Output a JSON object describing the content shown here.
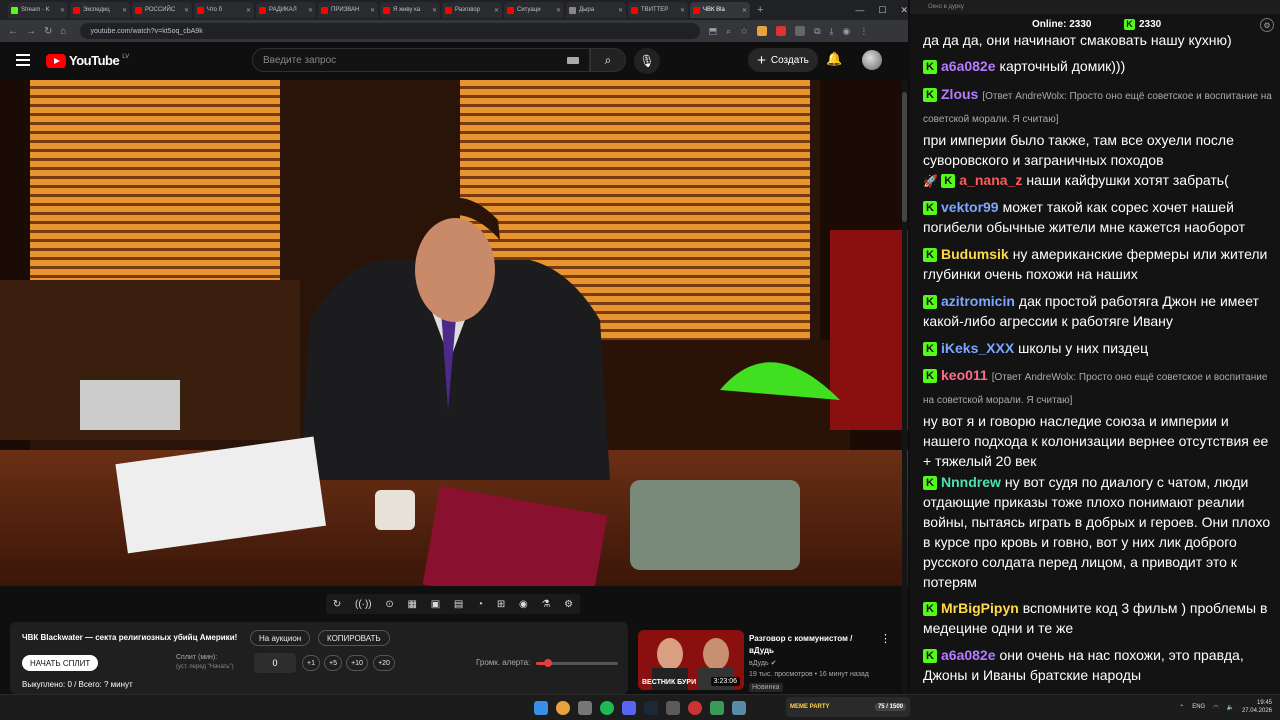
{
  "browser": {
    "tabs": [
      {
        "title": "Stream - K",
        "color": "#53fc18"
      },
      {
        "title": "Экспедиц",
        "color": "#ff0000"
      },
      {
        "title": "РОССИЙС",
        "color": "#ff0000"
      },
      {
        "title": "Что б",
        "color": "#ff0000"
      },
      {
        "title": "РАДИКАЛ",
        "color": "#ff0000"
      },
      {
        "title": "ПРИЗВАН",
        "color": "#ff0000"
      },
      {
        "title": "Я живу ка",
        "color": "#ff0000"
      },
      {
        "title": "Разговор",
        "color": "#ff0000"
      },
      {
        "title": "Ситуаци",
        "color": "#ff0000"
      },
      {
        "title": "Дыра",
        "color": "#888888"
      },
      {
        "title": "ТВИТТЕР",
        "color": "#ff0000"
      },
      {
        "title": "ЧВК Bla",
        "color": "#ff0000",
        "active": true
      }
    ],
    "url": "youtube.com/watch?v=kt5oq_cbA9k"
  },
  "youtube": {
    "logo_text": "YouTube",
    "region": "LV",
    "search_placeholder": "Введите запрос",
    "create_label": "Создать"
  },
  "player_controls": [
    "↻",
    "((·))",
    "⊙",
    "▦",
    "▣",
    "▤",
    "◔",
    "⊞",
    "◉",
    "⚗",
    "⚙"
  ],
  "auction": {
    "title": "ЧВК Blackwater — секта религиозных убийц Америки!",
    "btn_auction": "На аукцион",
    "btn_copy": "КОПИРОВАТЬ",
    "btn_start": "НАЧАТЬ СПЛИТ",
    "split_label": "Сплит (мин):",
    "split_sub": "(уст. перед \"Начать\")",
    "split_value": "0",
    "increments": [
      "+1",
      "+5",
      "+10",
      "+20"
    ],
    "volume_label": "Громк. алерта:",
    "volume_level": 0.15,
    "sold_text": "Выкуплено: 0 / Всего: ? минут"
  },
  "recommendation": {
    "title": "Разговор с коммунистом / вДудь",
    "channel": "вДудь",
    "meta": "19 тыс. просмотров • 16 минут назад",
    "badge_new": "Новинка",
    "duration": "3:23:06",
    "thumb_text": "ВЕСТНИК БУРИ"
  },
  "chat": {
    "window_title": "Окно в дурку",
    "online_label": "Online:",
    "online_count": "2330",
    "viewers_count": "2330",
    "messages": [
      {
        "user": "",
        "text": "да да да, они начинают смаковать нашу кухню)",
        "color": "#ffffff",
        "reply": ""
      },
      {
        "user": "a6a082e",
        "text": "карточный домик)))",
        "color": "#b57bff",
        "reply": ""
      },
      {
        "user": "Zlous",
        "text": "при империи было также, там все охуели после суворовского и заграничных походов",
        "color": "#b57bff",
        "reply": "[Ответ AndreWolx: Просто оно ещё советское и воспитание на советской морали. Я считаю]"
      },
      {
        "user": "a_nana_z",
        "text": "наши кайфушки хотят забрать(",
        "color": "#ff5a5a",
        "reply": ""
      },
      {
        "user": "vektor99",
        "text": "может такой как сорес хочет нашей погибели обычные жители мне кажется наоборот",
        "color": "#7aa7ff",
        "reply": ""
      },
      {
        "user": "Budumsik",
        "text": "ну американские фермеры или жители глубинки очень похожи на наших",
        "color": "#ffd94a",
        "reply": ""
      },
      {
        "user": "azitromicin",
        "text": "дак простой работяга Джон не имеет какой-либо агрессии к работяге Ивану",
        "color": "#7aa7ff",
        "reply": ""
      },
      {
        "user": "iKeks_XXX",
        "text": "школы у них пиздец",
        "color": "#7aa7ff",
        "reply": ""
      },
      {
        "user": "keo011",
        "text": "ну вот я и говорю наследие союза и империи и нашего подхода к колонизации вернее отсутствия ее + тяжелый 20 век",
        "color": "#ff6b8a",
        "reply": "[Ответ AndreWolx: Просто оно ещё советское и воспитание на советской морали. Я считаю]"
      },
      {
        "user": "Nnndrew",
        "text": "ну вот судя по диалогу с чатом, люди отдающие приказы тоже плохо понимают реалии войны, пытаясь играть в добрых и героев. Они плохо в курсе про кровь и говно, вот у них лик доброго русского солдата перед лицом, а приводит это к потерям",
        "color": "#4ee0b0",
        "reply": ""
      },
      {
        "user": "MrBigPipyn",
        "text": "вспомните код 3 фильм ) проблемы в медецине одни и те же",
        "color": "#ffd94a",
        "reply": ""
      },
      {
        "user": "a6a082e",
        "text": "они очень на нас похожи, это правда, Джоны и Иваны братские народы",
        "color": "#b57bff",
        "reply": ""
      }
    ]
  },
  "taskbar": {
    "memes_label": "MEME PARTY",
    "memes_count": "75 / 1500",
    "lang": "ENG",
    "time": "19:45",
    "date": "27.04.2026"
  }
}
